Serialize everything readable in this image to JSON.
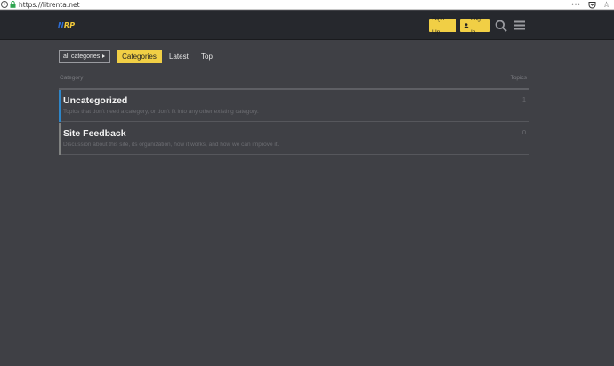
{
  "browser": {
    "url": "https://litrenta.net",
    "info_glyph": "i",
    "more_glyph": "•••",
    "star_glyph": "☆",
    "icons": [
      "info-icon",
      "lock-icon",
      "more-icon",
      "pocket-icon",
      "bookmark-star-icon"
    ]
  },
  "header": {
    "logo_first": "N",
    "logo_rest": "RP",
    "signup_label": "Sign Up",
    "login_label": "Log In",
    "icons": [
      "user-icon",
      "search-icon",
      "hamburger-menu-icon"
    ]
  },
  "nav": {
    "dropdown_label": "all categories",
    "tabs": [
      {
        "label": "Categories",
        "active": true
      },
      {
        "label": "Latest",
        "active": false
      },
      {
        "label": "Top",
        "active": false
      }
    ]
  },
  "table": {
    "col_category": "Category",
    "col_topics": "Topics",
    "rows": [
      {
        "name": "Uncategorized",
        "description": "Topics that don't need a category, or don't fit into any other existing category.",
        "topics": "1",
        "color": "#2f86c8"
      },
      {
        "name": "Site Feedback",
        "description": "Discussion about this site, its organization, how it works, and how we can improve it.",
        "topics": "0",
        "color": "#808281"
      }
    ]
  },
  "colors": {
    "accent_yellow": "#f1cf45",
    "header_bg": "#26282d",
    "page_bg": "#3f4045"
  }
}
